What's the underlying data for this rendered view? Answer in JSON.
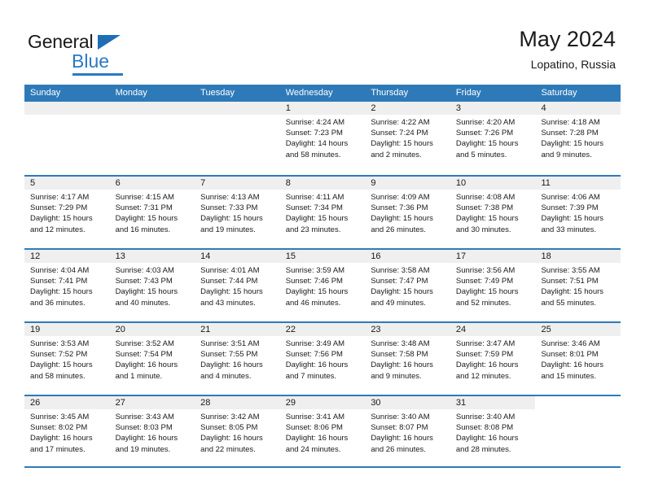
{
  "brand": {
    "name_part1": "General",
    "name_part2": "Blue",
    "flag_icon": "triangle-flag-icon"
  },
  "header": {
    "title": "May 2024",
    "location": "Lopatino, Russia"
  },
  "colors": {
    "header_blue": "#2e7ab8",
    "brand_blue": "#2a7ac4",
    "day_head_gray": "#efefef",
    "text": "#1a1a1a"
  },
  "weekdays": [
    "Sunday",
    "Monday",
    "Tuesday",
    "Wednesday",
    "Thursday",
    "Friday",
    "Saturday"
  ],
  "weeks": [
    [
      {
        "day": "",
        "blank": true,
        "sunrise": "",
        "sunset": "",
        "daylight1": "",
        "daylight2": ""
      },
      {
        "day": "",
        "blank": true,
        "sunrise": "",
        "sunset": "",
        "daylight1": "",
        "daylight2": ""
      },
      {
        "day": "",
        "blank": true,
        "sunrise": "",
        "sunset": "",
        "daylight1": "",
        "daylight2": ""
      },
      {
        "day": "1",
        "sunrise": "Sunrise: 4:24 AM",
        "sunset": "Sunset: 7:23 PM",
        "daylight1": "Daylight: 14 hours",
        "daylight2": "and 58 minutes."
      },
      {
        "day": "2",
        "sunrise": "Sunrise: 4:22 AM",
        "sunset": "Sunset: 7:24 PM",
        "daylight1": "Daylight: 15 hours",
        "daylight2": "and 2 minutes."
      },
      {
        "day": "3",
        "sunrise": "Sunrise: 4:20 AM",
        "sunset": "Sunset: 7:26 PM",
        "daylight1": "Daylight: 15 hours",
        "daylight2": "and 5 minutes."
      },
      {
        "day": "4",
        "sunrise": "Sunrise: 4:18 AM",
        "sunset": "Sunset: 7:28 PM",
        "daylight1": "Daylight: 15 hours",
        "daylight2": "and 9 minutes."
      }
    ],
    [
      {
        "day": "5",
        "sunrise": "Sunrise: 4:17 AM",
        "sunset": "Sunset: 7:29 PM",
        "daylight1": "Daylight: 15 hours",
        "daylight2": "and 12 minutes."
      },
      {
        "day": "6",
        "sunrise": "Sunrise: 4:15 AM",
        "sunset": "Sunset: 7:31 PM",
        "daylight1": "Daylight: 15 hours",
        "daylight2": "and 16 minutes."
      },
      {
        "day": "7",
        "sunrise": "Sunrise: 4:13 AM",
        "sunset": "Sunset: 7:33 PM",
        "daylight1": "Daylight: 15 hours",
        "daylight2": "and 19 minutes."
      },
      {
        "day": "8",
        "sunrise": "Sunrise: 4:11 AM",
        "sunset": "Sunset: 7:34 PM",
        "daylight1": "Daylight: 15 hours",
        "daylight2": "and 23 minutes."
      },
      {
        "day": "9",
        "sunrise": "Sunrise: 4:09 AM",
        "sunset": "Sunset: 7:36 PM",
        "daylight1": "Daylight: 15 hours",
        "daylight2": "and 26 minutes."
      },
      {
        "day": "10",
        "sunrise": "Sunrise: 4:08 AM",
        "sunset": "Sunset: 7:38 PM",
        "daylight1": "Daylight: 15 hours",
        "daylight2": "and 30 minutes."
      },
      {
        "day": "11",
        "sunrise": "Sunrise: 4:06 AM",
        "sunset": "Sunset: 7:39 PM",
        "daylight1": "Daylight: 15 hours",
        "daylight2": "and 33 minutes."
      }
    ],
    [
      {
        "day": "12",
        "sunrise": "Sunrise: 4:04 AM",
        "sunset": "Sunset: 7:41 PM",
        "daylight1": "Daylight: 15 hours",
        "daylight2": "and 36 minutes."
      },
      {
        "day": "13",
        "sunrise": "Sunrise: 4:03 AM",
        "sunset": "Sunset: 7:43 PM",
        "daylight1": "Daylight: 15 hours",
        "daylight2": "and 40 minutes."
      },
      {
        "day": "14",
        "sunrise": "Sunrise: 4:01 AM",
        "sunset": "Sunset: 7:44 PM",
        "daylight1": "Daylight: 15 hours",
        "daylight2": "and 43 minutes."
      },
      {
        "day": "15",
        "sunrise": "Sunrise: 3:59 AM",
        "sunset": "Sunset: 7:46 PM",
        "daylight1": "Daylight: 15 hours",
        "daylight2": "and 46 minutes."
      },
      {
        "day": "16",
        "sunrise": "Sunrise: 3:58 AM",
        "sunset": "Sunset: 7:47 PM",
        "daylight1": "Daylight: 15 hours",
        "daylight2": "and 49 minutes."
      },
      {
        "day": "17",
        "sunrise": "Sunrise: 3:56 AM",
        "sunset": "Sunset: 7:49 PM",
        "daylight1": "Daylight: 15 hours",
        "daylight2": "and 52 minutes."
      },
      {
        "day": "18",
        "sunrise": "Sunrise: 3:55 AM",
        "sunset": "Sunset: 7:51 PM",
        "daylight1": "Daylight: 15 hours",
        "daylight2": "and 55 minutes."
      }
    ],
    [
      {
        "day": "19",
        "sunrise": "Sunrise: 3:53 AM",
        "sunset": "Sunset: 7:52 PM",
        "daylight1": "Daylight: 15 hours",
        "daylight2": "and 58 minutes."
      },
      {
        "day": "20",
        "sunrise": "Sunrise: 3:52 AM",
        "sunset": "Sunset: 7:54 PM",
        "daylight1": "Daylight: 16 hours",
        "daylight2": "and 1 minute."
      },
      {
        "day": "21",
        "sunrise": "Sunrise: 3:51 AM",
        "sunset": "Sunset: 7:55 PM",
        "daylight1": "Daylight: 16 hours",
        "daylight2": "and 4 minutes."
      },
      {
        "day": "22",
        "sunrise": "Sunrise: 3:49 AM",
        "sunset": "Sunset: 7:56 PM",
        "daylight1": "Daylight: 16 hours",
        "daylight2": "and 7 minutes."
      },
      {
        "day": "23",
        "sunrise": "Sunrise: 3:48 AM",
        "sunset": "Sunset: 7:58 PM",
        "daylight1": "Daylight: 16 hours",
        "daylight2": "and 9 minutes."
      },
      {
        "day": "24",
        "sunrise": "Sunrise: 3:47 AM",
        "sunset": "Sunset: 7:59 PM",
        "daylight1": "Daylight: 16 hours",
        "daylight2": "and 12 minutes."
      },
      {
        "day": "25",
        "sunrise": "Sunrise: 3:46 AM",
        "sunset": "Sunset: 8:01 PM",
        "daylight1": "Daylight: 16 hours",
        "daylight2": "and 15 minutes."
      }
    ],
    [
      {
        "day": "26",
        "sunrise": "Sunrise: 3:45 AM",
        "sunset": "Sunset: 8:02 PM",
        "daylight1": "Daylight: 16 hours",
        "daylight2": "and 17 minutes."
      },
      {
        "day": "27",
        "sunrise": "Sunrise: 3:43 AM",
        "sunset": "Sunset: 8:03 PM",
        "daylight1": "Daylight: 16 hours",
        "daylight2": "and 19 minutes."
      },
      {
        "day": "28",
        "sunrise": "Sunrise: 3:42 AM",
        "sunset": "Sunset: 8:05 PM",
        "daylight1": "Daylight: 16 hours",
        "daylight2": "and 22 minutes."
      },
      {
        "day": "29",
        "sunrise": "Sunrise: 3:41 AM",
        "sunset": "Sunset: 8:06 PM",
        "daylight1": "Daylight: 16 hours",
        "daylight2": "and 24 minutes."
      },
      {
        "day": "30",
        "sunrise": "Sunrise: 3:40 AM",
        "sunset": "Sunset: 8:07 PM",
        "daylight1": "Daylight: 16 hours",
        "daylight2": "and 26 minutes."
      },
      {
        "day": "31",
        "sunrise": "Sunrise: 3:40 AM",
        "sunset": "Sunset: 8:08 PM",
        "daylight1": "Daylight: 16 hours",
        "daylight2": "and 28 minutes."
      },
      {
        "day": "",
        "empty_nohead": true,
        "sunrise": "",
        "sunset": "",
        "daylight1": "",
        "daylight2": ""
      }
    ]
  ]
}
